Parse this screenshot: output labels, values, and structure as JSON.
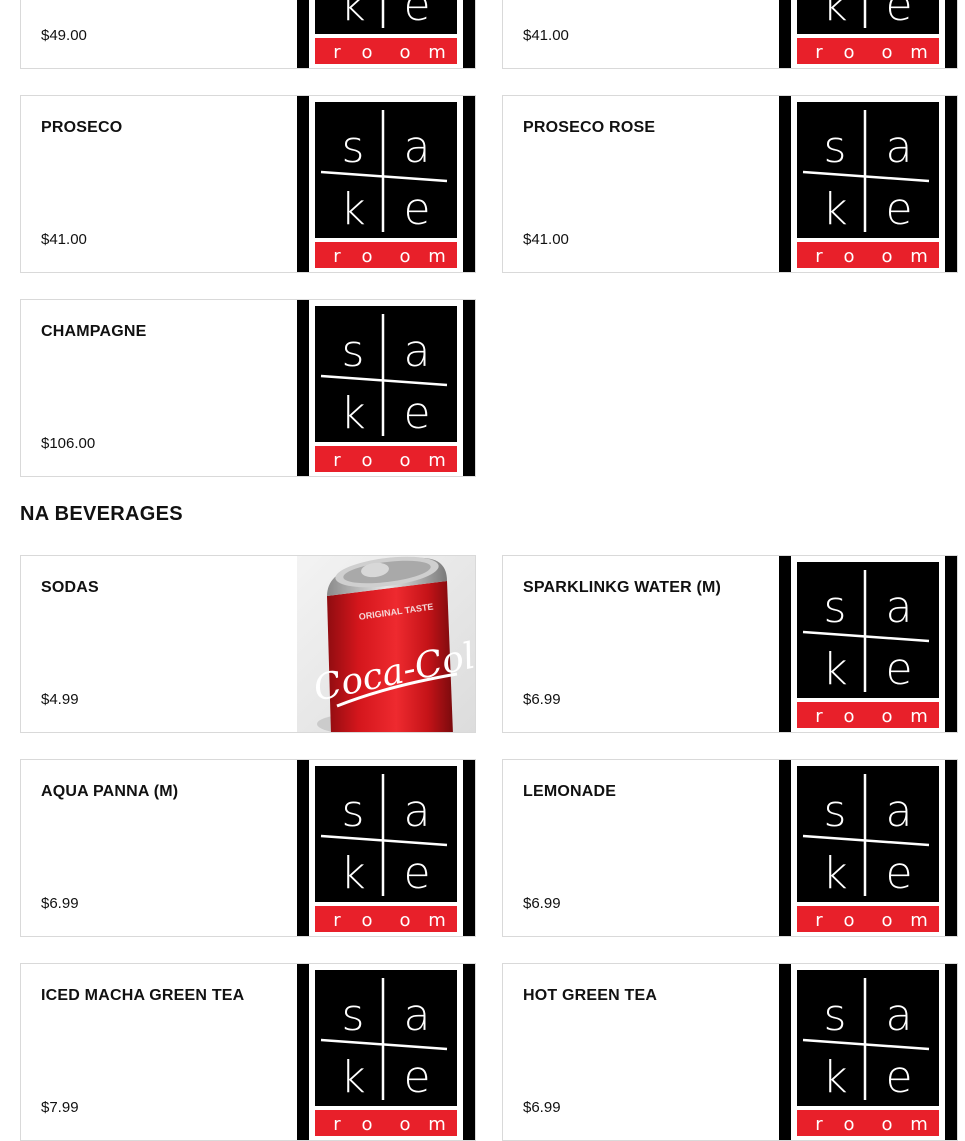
{
  "top_row": [
    {
      "price": "$49.00"
    },
    {
      "price": "$41.00"
    }
  ],
  "logo_text": {
    "s": "s",
    "a": "a",
    "k": "k",
    "e": "e",
    "room": [
      "r",
      "o",
      "o",
      "m"
    ]
  },
  "sections": {
    "wine": {
      "items": [
        {
          "name": "PROSECO",
          "price": "$41.00"
        },
        {
          "name": "PROSECO ROSE",
          "price": "$41.00"
        },
        {
          "name": "CHAMPAGNE",
          "price": "$106.00"
        }
      ]
    },
    "na_beverages": {
      "title": "NA BEVERAGES",
      "items": [
        {
          "name": "SODAS",
          "price": "$4.99",
          "image": "coca-cola-can"
        },
        {
          "name": "SPARKLINKG WATER (M)",
          "price": "$6.99"
        },
        {
          "name": "AQUA PANNA (M)",
          "price": "$6.99"
        },
        {
          "name": "LEMONADE",
          "price": "$6.99"
        },
        {
          "name": "ICED MACHA GREEN TEA",
          "price": "$7.99"
        },
        {
          "name": "HOT GREEN TEA",
          "price": "$6.99"
        }
      ]
    }
  },
  "can_text": {
    "top": "ORIGINAL TASTE",
    "brand": "Coca-Cola"
  },
  "colors": {
    "logo_black": "#000000",
    "logo_red": "#e8202a",
    "border": "#d9d9d9"
  }
}
